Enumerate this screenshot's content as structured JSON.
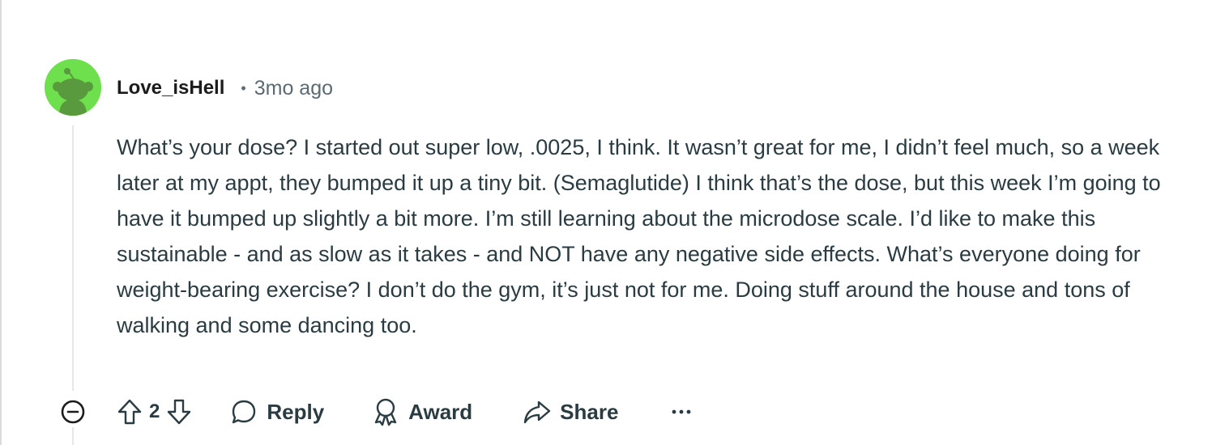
{
  "comment": {
    "username": "Love_isHell",
    "separator": "•",
    "timestamp": "3mo ago",
    "body": "What’s your dose? I started out super low, .0025, I think. It wasn’t great for me, I didn’t feel much, so a week later at my appt, they bumped it up a tiny bit. (Semaglutide) I think that’s the dose, but this week I’m going to have it bumped up slightly a bit more. I’m still learning about the microdose scale. I’d like to make this sustainable - and as slow as it takes - and NOT have any negative side effects. What’s everyone doing for weight-bearing exercise? I don’t do the gym, it’s just not for me. Doing stuff around the house and tons of walking and some dancing too.",
    "score": "2",
    "avatar_color": "#6fe04d"
  },
  "actions": {
    "reply_label": "Reply",
    "award_label": "Award",
    "share_label": "Share",
    "more_label": "···"
  },
  "icons": {
    "collapse": "collapse-thread-icon",
    "upvote": "upvote-arrow-icon",
    "downvote": "downvote-arrow-icon",
    "reply": "speech-bubble-icon",
    "award": "award-ribbon-icon",
    "share": "share-arrow-icon",
    "more": "ellipsis-icon"
  },
  "colors": {
    "text_primary": "#1c1c1c",
    "text_body": "#2a3c42",
    "text_secondary": "#5c6a73",
    "thread_line": "#e5e7e8"
  }
}
